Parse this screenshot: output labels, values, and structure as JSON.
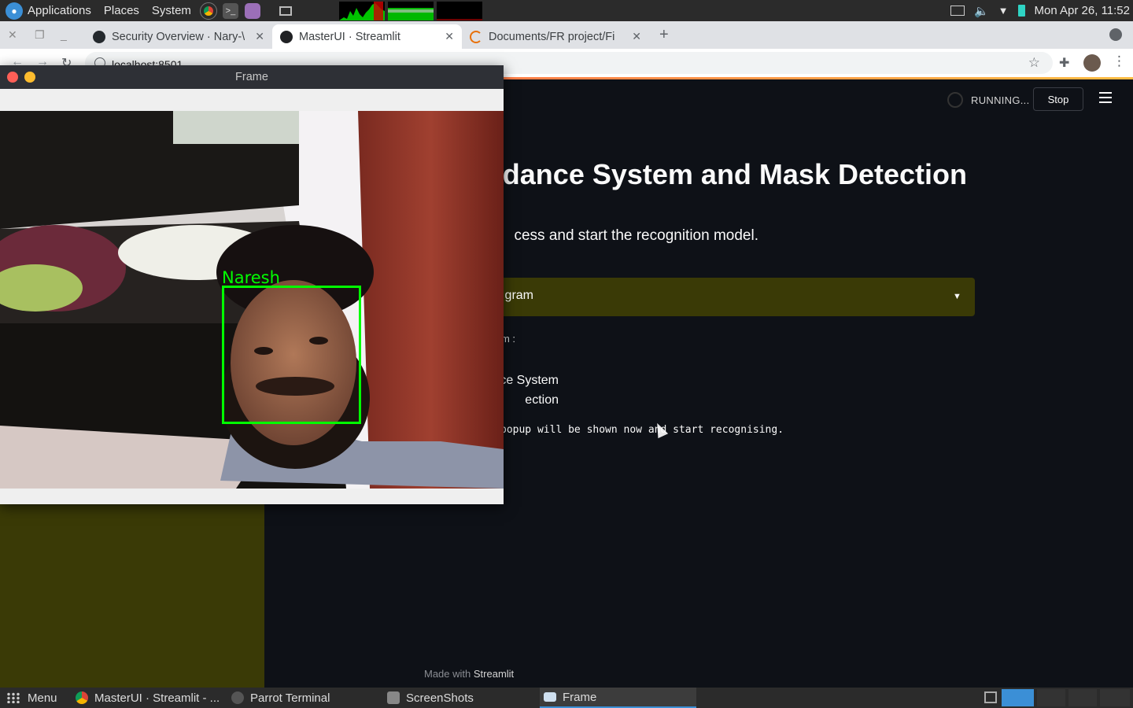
{
  "system_panel": {
    "menus": [
      "Applications",
      "Places",
      "System"
    ],
    "clock": "Mon Apr 26, 11:52"
  },
  "browser": {
    "tabs": [
      {
        "label": "Security Overview · Nary-\\"
      },
      {
        "label": "MasterUI · Streamlit"
      },
      {
        "label": "Documents/FR project/Fi"
      }
    ],
    "url": "localhost:8501"
  },
  "streamlit": {
    "status": "RUNNING...",
    "stop_label": "Stop",
    "title_visible": "dance System and Mask Detection",
    "subtitle_visible": "cess and start the recognition model.",
    "select_value_visible": "gram",
    "radio_label_visible": "m :",
    "radio_options_visible": [
      "ce System",
      "ection"
    ],
    "code_text_visible": "popup will be shown now and start recognising.",
    "footer_prefix": "Made with",
    "footer_brand": "Streamlit"
  },
  "frame_window": {
    "title": "Frame",
    "detection_label": "Naresh"
  },
  "taskbar": {
    "menu_label": "Menu",
    "items": [
      {
        "label": "MasterUI · Streamlit - ..."
      },
      {
        "label": "Parrot Terminal"
      },
      {
        "label": "ScreenShots"
      },
      {
        "label": "Frame"
      }
    ]
  },
  "colors": {
    "streamlit_bg": "#0e1117",
    "sidebar_olive": "#3a3a06",
    "detection_green": "#00ff00",
    "close_red": "#ff5f57",
    "minimize_yellow": "#febc2e"
  }
}
